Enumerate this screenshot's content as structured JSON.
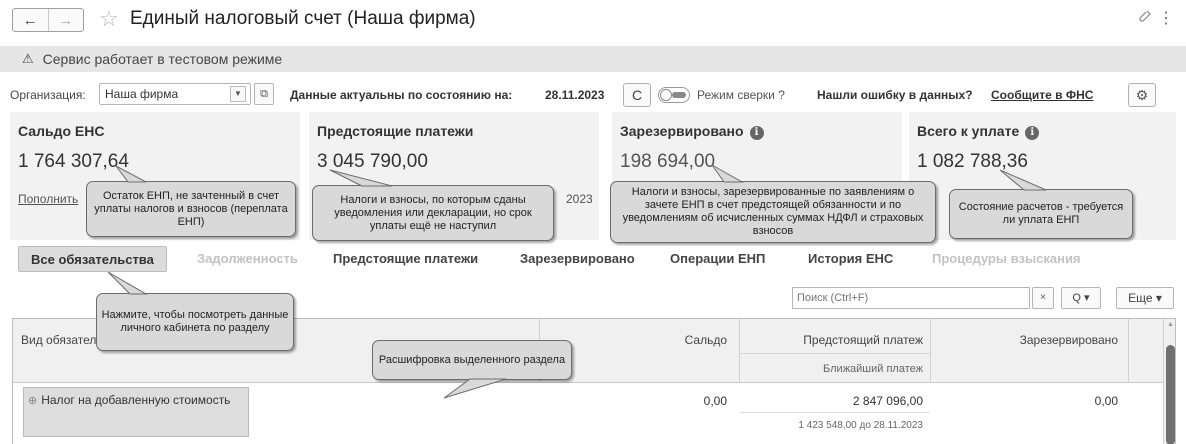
{
  "window": {
    "title": "Единый налоговый счет (Наша фирма)",
    "back_icon": "←",
    "forward_icon": "→",
    "star_icon": "☆",
    "link_icon": "🔗",
    "more_icon": "⋮"
  },
  "banner": {
    "icon": "⚠",
    "text": "Сервис работает в тестовом режиме"
  },
  "filters": {
    "org_label": "Организация:",
    "org_value": "Наша фирма",
    "dropdown_icon": "▼",
    "open_icon": "⧉",
    "actual_label": "Данные актуальны по состоянию на:",
    "actual_date": "28.11.2023",
    "refresh_icon": "C",
    "recon_label": "Режим сверки ?",
    "error_label": "Нашли ошибку в данных?",
    "error_link": "Сообщите в ФНС",
    "gear_icon": "⚙"
  },
  "summary": {
    "saldo": {
      "title": "Сальдо ЕНС",
      "value": "1 764 307,64",
      "link": "Пополнить"
    },
    "upcoming": {
      "title": "Предстоящие платежи",
      "value": "3 045 790,00",
      "sub": "2023"
    },
    "reserved": {
      "title": "Зарезервировано",
      "value": "198 694,00",
      "info": "i"
    },
    "total": {
      "title": "Всего к уплате",
      "value": "1 082 788,36",
      "info": "i"
    }
  },
  "callouts": {
    "saldo": "Остаток ЕНП, не зачтенный в счет уплаты налогов и взносов (переплата ЕНП)",
    "upcoming": "Налоги и взносы, по которым сданы уведомления или декларации, но срок уплаты ещё не наступил",
    "reserved": "Налоги и взносы, зарезервированные по заявлениям о зачете ЕНП в счет предстоящей обязанности и по уведомлениям об исчисленных суммах НДФЛ и страховых взносов",
    "total": "Состояние расчетов - требуется ли уплата ЕНП",
    "tabs": "Нажмите, чтобы посмотреть данные личного кабинета по разделу",
    "table": "Расшифровка выделенного раздела"
  },
  "tabs": [
    {
      "label": "Все обязательства",
      "state": "active"
    },
    {
      "label": "Задолженность",
      "state": "muted"
    },
    {
      "label": "Предстоящие платежи",
      "state": "normal"
    },
    {
      "label": "Зарезервировано",
      "state": "normal"
    },
    {
      "label": "Операции ЕНП",
      "state": "normal"
    },
    {
      "label": "История ЕНС",
      "state": "normal"
    },
    {
      "label": "Процедуры взыскания",
      "state": "muted"
    }
  ],
  "search": {
    "placeholder": "Поиск (Ctrl+F)",
    "clear_icon": "×",
    "search_icon": "Q ▾",
    "more_label": "Еще ▾"
  },
  "table": {
    "headers": {
      "name": "Вид обязател",
      "saldo": "Сальдо",
      "upcoming": "Предстоящий платеж",
      "nearest": "Ближайший платеж",
      "reserved": "Зарезервировано"
    },
    "rows": [
      {
        "expand_icon": "⊕",
        "name": "Налог на добавленную стоимость",
        "saldo": "0,00",
        "upcoming": "2 847 096,00",
        "nearest": "1 423 548,00 до 28.11.2023",
        "reserved": "0,00"
      }
    ]
  }
}
